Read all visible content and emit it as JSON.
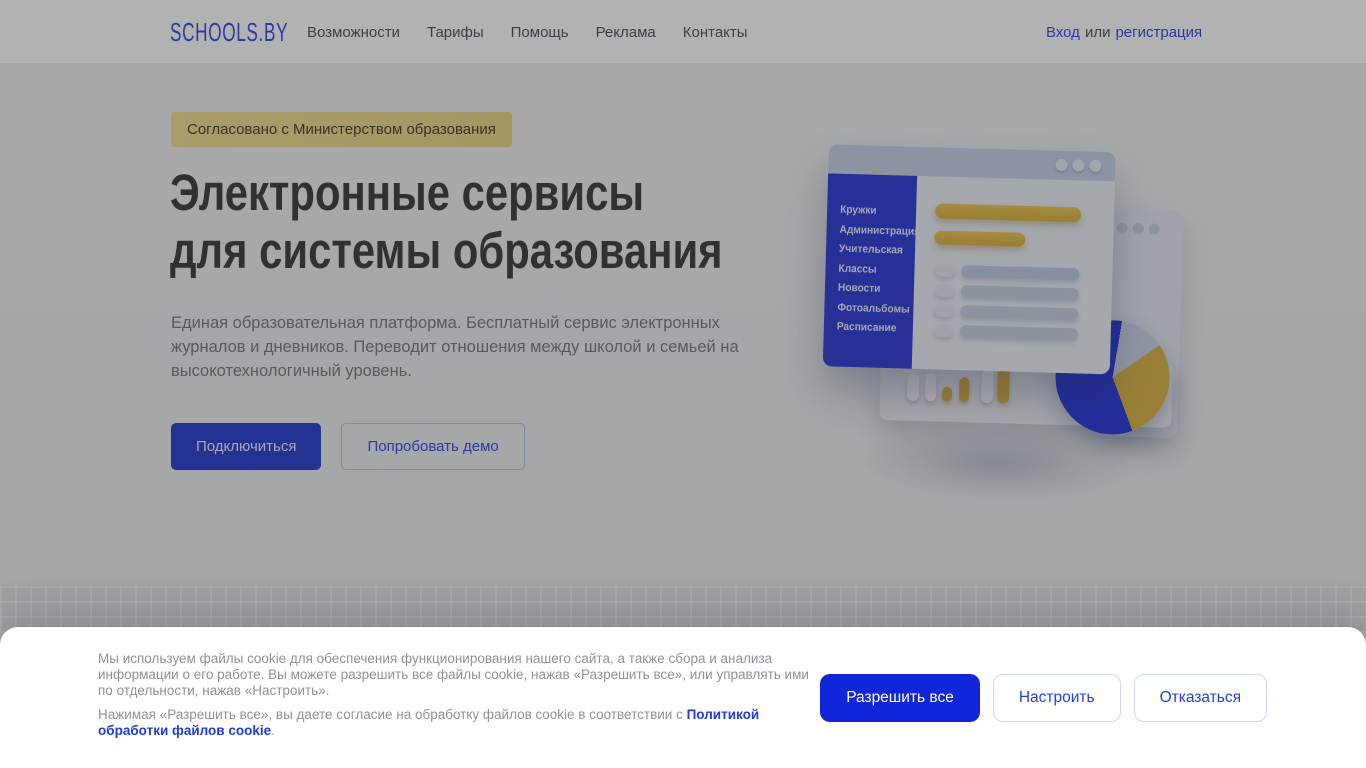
{
  "header": {
    "logo": "SCHOOLS.BY",
    "nav": [
      "Возможности",
      "Тарифы",
      "Помощь",
      "Реклама",
      "Контакты"
    ],
    "auth": {
      "login": "Вход",
      "separator": "или",
      "register": "регистрация"
    }
  },
  "hero": {
    "badge": "Согласовано с Министерством образования",
    "title_line1": "Электронные сервисы",
    "title_line2": "для системы образования",
    "description": "Единая образовательная платформа. Бесплатный сервис электронных журналов и дневников. Переводит отношения между школой и семьей на высокотехнологичный уровень.",
    "primary_cta": "Подключиться",
    "secondary_cta": "Попробовать демо"
  },
  "illustration": {
    "sidebar_items": [
      "Кружки",
      "Администрация",
      "Учительская",
      "Классы",
      "Новости",
      "Фотоальбомы",
      "Расписание"
    ]
  },
  "cookie_banner": {
    "paragraph1": "Мы используем файлы cookie для обеспечения функционирования нашего сайта, а также сбора и анализа информации о его работе. Вы можете разрешить все файлы cookie, нажав «Разрешить все», или управлять ими по отдельности, нажав «Настроить».",
    "paragraph2_prefix": "Нажимая «Разрешить все», вы даете согласие на обработку файлов cookie в соответствии с ",
    "paragraph2_link": "Политикой обработки файлов cookie",
    "paragraph2_suffix": ".",
    "buttons": {
      "allow": "Разрешить все",
      "configure": "Настроить",
      "decline": "Отказаться"
    }
  },
  "colors": {
    "brand_blue": "#3c53e8",
    "primary_button_blue": "#3448d4",
    "cookie_primary_blue": "#1126d9",
    "badge_yellow": "#f1de92",
    "illustration_sidebar_blue": "#3845d8",
    "illustration_yellow": "#e2bc52",
    "overlay": "rgba(0,0,0,0.30)",
    "heading_text": "#44474d",
    "body_text": "#7b818b",
    "cookie_text": "#8d929b"
  }
}
